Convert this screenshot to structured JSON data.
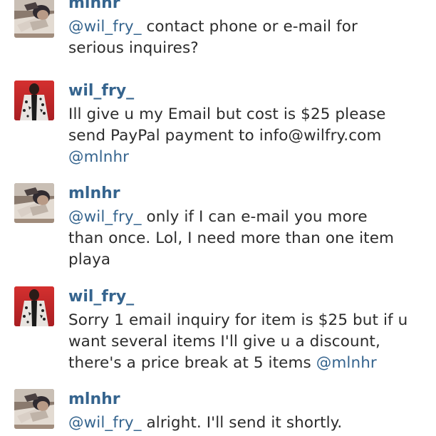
{
  "comments": [
    {
      "username": "mlnhr",
      "avatar": "man-lying-photo",
      "lines": [
        [
          {
            "t": "@wil_fry_",
            "m": true
          },
          {
            "t": " contact phone or e-mail for"
          }
        ],
        [
          {
            "t": "serious inquires?"
          }
        ]
      ]
    },
    {
      "username": "wil_fry_",
      "avatar": "red-jacket-photo",
      "lines": [
        [
          {
            "t": "Ill give u my Email but cost is $25 please"
          }
        ],
        [
          {
            "t": "send PayPal payment to info@wilfry.com"
          }
        ],
        [
          {
            "t": "@mlnhr",
            "m": true
          }
        ]
      ]
    },
    {
      "username": "mlnhr",
      "avatar": "man-lying-photo",
      "lines": [
        [
          {
            "t": "@wil_fry_",
            "m": true
          },
          {
            "t": " only if I can e-mail you more"
          }
        ],
        [
          {
            "t": "than once. Lol, I need more than one item"
          }
        ],
        [
          {
            "t": "playa"
          }
        ]
      ]
    },
    {
      "username": "wil_fry_",
      "avatar": "red-jacket-photo",
      "lines": [
        [
          {
            "t": "Sorry 1 email inquiry for item is $25 but if u"
          }
        ],
        [
          {
            "t": "want several items I'll give u a discount,"
          }
        ],
        [
          {
            "t": "there's a price break at 5 items "
          },
          {
            "t": "@mlnhr",
            "m": true
          }
        ]
      ]
    },
    {
      "username": "mlnhr",
      "avatar": "man-lying-photo",
      "lines": [
        [
          {
            "t": "@wil_fry_",
            "m": true
          },
          {
            "t": " alright. I'll send it shortly."
          }
        ]
      ]
    }
  ],
  "colors": {
    "username": "#35648e",
    "mention": "#35648e",
    "text": "#2c2c2c",
    "background": "#ffffff"
  }
}
